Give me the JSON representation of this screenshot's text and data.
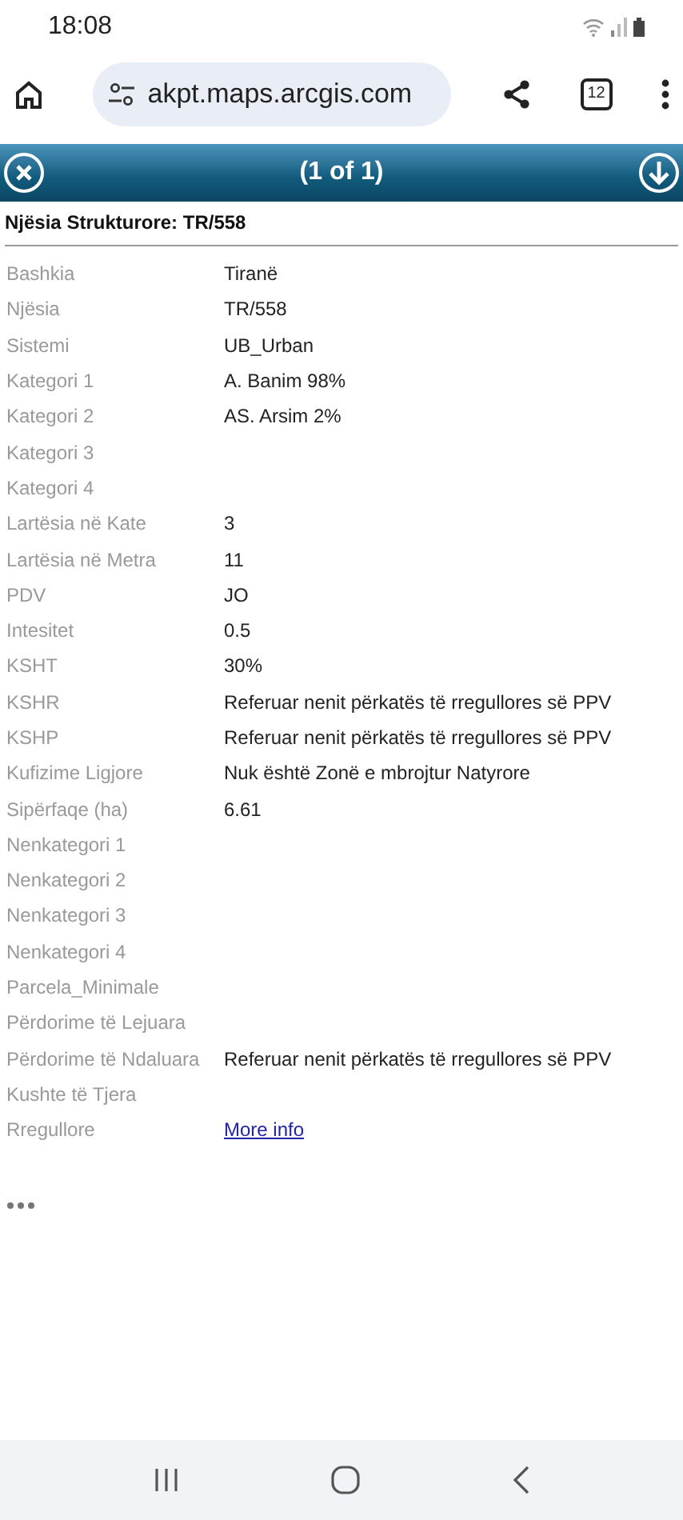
{
  "status_bar": {
    "time": "18:08"
  },
  "browser": {
    "url": "akpt.maps.arcgis.com",
    "tab_count": "12"
  },
  "popup": {
    "counter": "(1 of 1)",
    "title": "Njësia Strukturore: TR/558",
    "rows": [
      {
        "label": "Bashkia",
        "value": "Tiranë",
        "kind": "text"
      },
      {
        "label": "Njësia",
        "value": "TR/558",
        "kind": "text"
      },
      {
        "label": "Sistemi",
        "value": "UB_Urban",
        "kind": "text"
      },
      {
        "label": "Kategori 1",
        "value": "A. Banim 98%",
        "kind": "text"
      },
      {
        "label": "Kategori 2",
        "value": "AS. Arsim 2%",
        "kind": "text"
      },
      {
        "label": "Kategori 3"
      },
      {
        "label": "Kategori 4"
      },
      {
        "label": "Lartësia në Kate",
        "value": "3",
        "kind": "text"
      },
      {
        "label": "Lartësia në Metra",
        "value": "11",
        "kind": "text"
      },
      {
        "label": "PDV",
        "value": "JO",
        "kind": "text"
      },
      {
        "label": "Intesitet",
        "value": "0.5",
        "kind": "text"
      },
      {
        "label": "KSHT",
        "value": "30%",
        "kind": "text"
      },
      {
        "label": "KSHR",
        "value": "Referuar nenit përkatës të rregullores së PPV",
        "kind": "text"
      },
      {
        "label": "KSHP",
        "value": "Referuar nenit përkatës të rregullores së PPV",
        "kind": "text"
      },
      {
        "label": "Kufizime Ligjore",
        "value": "Nuk është Zonë e mbrojtur Natyrore",
        "kind": "text"
      },
      {
        "label": "Sipërfaqe (ha)",
        "value": "6.61",
        "kind": "text"
      },
      {
        "label": "Nenkategori 1"
      },
      {
        "label": "Nenkategori 2"
      },
      {
        "label": "Nenkategori 3"
      },
      {
        "label": "Nenkategori 4"
      },
      {
        "label": "Parcela_Minimale"
      },
      {
        "label": "Përdorime të Lejuara"
      },
      {
        "label": "Përdorime të Ndaluara",
        "value": "Referuar nenit përkatës të rregullores së PPV",
        "kind": "text"
      },
      {
        "label": "Kushte të Tjera"
      },
      {
        "label": "Rregullore",
        "value": "More info",
        "kind": "link"
      }
    ]
  }
}
